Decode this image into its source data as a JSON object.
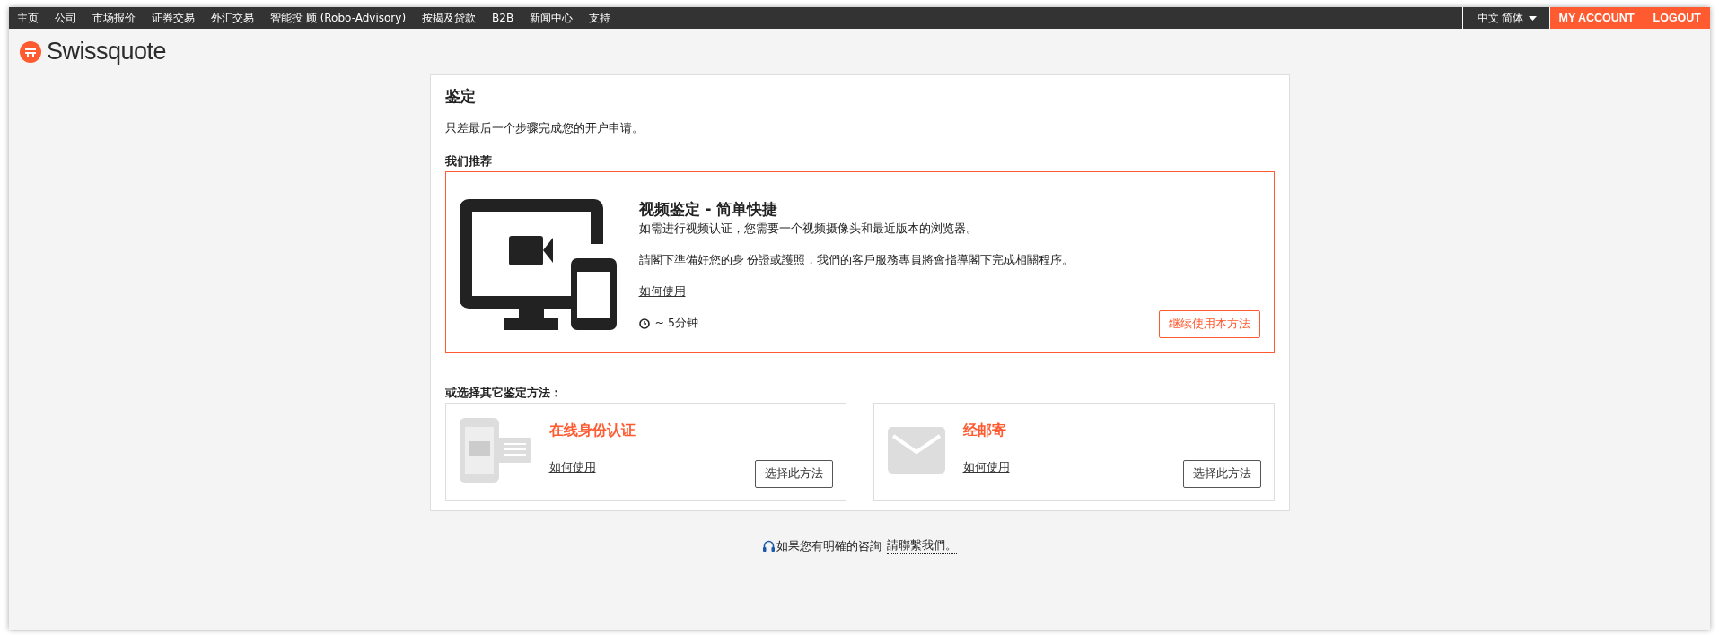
{
  "nav": {
    "items": [
      "主页",
      "公司",
      "市场报价",
      "证券交易",
      "外汇交易",
      "智能投 顾 (Robo-Advisory)",
      "按揭及贷款",
      "B2B",
      "新闻中心",
      "支持"
    ],
    "language": "中文 简体",
    "account_button": "MY ACCOUNT",
    "logout_button": "LOGOUT"
  },
  "logo": {
    "text": "Swissquote"
  },
  "card": {
    "title": "鉴定",
    "intro": "只差最后一个步骤完成您的开户申请。",
    "recommended_label": "我们推荐",
    "recommended": {
      "title": "视频鉴定 - 简单快捷",
      "description": "如需进行视频认证，您需要一个视频摄像头和最近版本的浏览器。",
      "note": "請閣下準備好您的身 份證或護照，我們的客戶服務專員將會指導閣下完成相關程序。",
      "how_link": "如何使用",
      "duration": "~ 5分钟",
      "button": "继续使用本方法"
    },
    "others_label": "或选择其它鉴定方法：",
    "others": [
      {
        "kind": "id-card",
        "title": "在线身份认证",
        "how_link": "如何使用",
        "button": "选择此方法"
      },
      {
        "kind": "mail",
        "title": "经邮寄",
        "how_link": "如何使用",
        "button": "选择此方法"
      }
    ]
  },
  "footer": {
    "text": "如果您有明確的咨詢",
    "link": "請聯繫我們。"
  }
}
